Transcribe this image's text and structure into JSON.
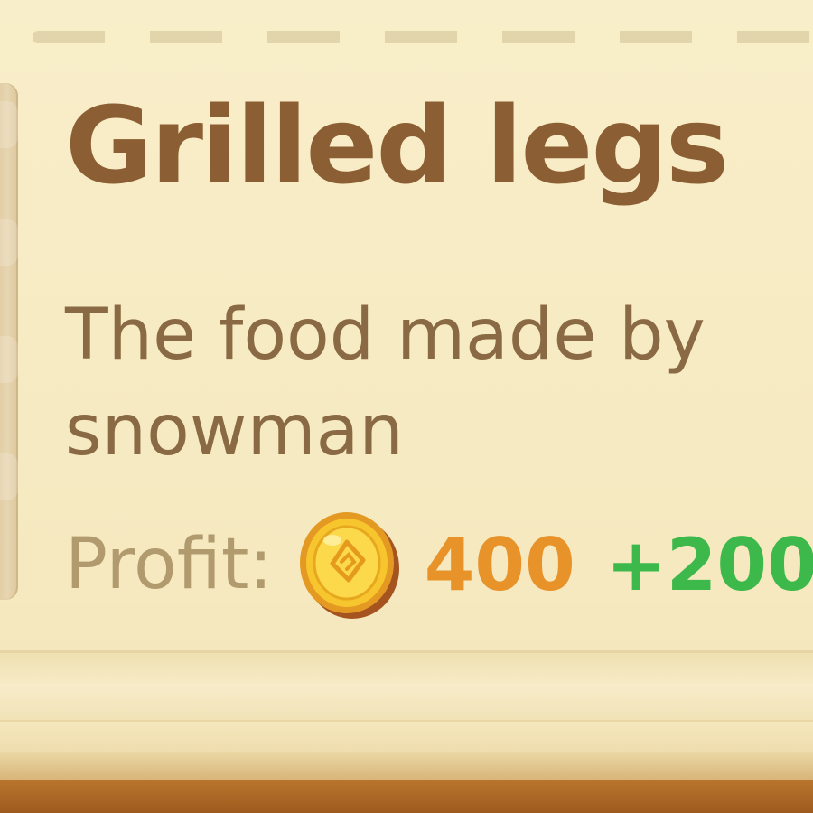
{
  "item": {
    "title": "Grilled legs",
    "description_lines": [
      "The food made by",
      "snowman"
    ],
    "profit": {
      "label": "Profit:",
      "currency_icon": "gold-coin-icon",
      "value": "400",
      "bonus": "+200"
    }
  },
  "colors": {
    "title": "#8b5e33",
    "description": "#8a6a44",
    "profit_label": "#b09a6e",
    "profit_value": "#e8922a",
    "profit_bonus": "#3cb94a",
    "panel_background": "#f7ebc4"
  }
}
